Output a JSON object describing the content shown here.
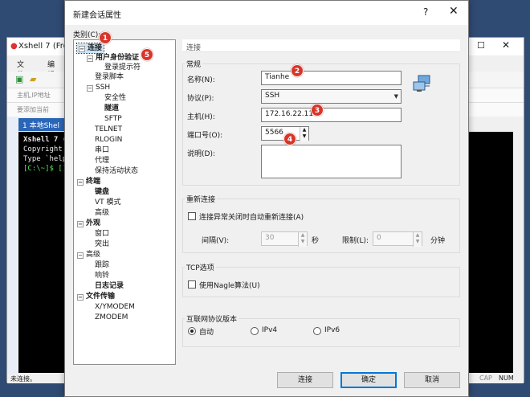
{
  "bg": {
    "title": "Xshell 7 (Fre",
    "menu": [
      "文件(F)",
      "编辑("
    ],
    "addr_hint": "主机,IP地址",
    "hint2": "要添加当前",
    "tab": "1 本地Shel",
    "term_lines": [
      "Xshell 7 (B",
      "Copyright",
      "",
      "Type `help",
      "[C:\\~]$ []"
    ],
    "status_left": "未连接。",
    "status_right": [
      "CAP",
      "NUM"
    ]
  },
  "dialog": {
    "title": "新建会话属性",
    "help": "?",
    "close": "✕",
    "category_label": "类别(C):",
    "tree": [
      {
        "label": "连接",
        "bold": true,
        "expander": "−",
        "selected": true
      },
      {
        "label": "用户身份验证",
        "bold": true,
        "expander": "−"
      },
      {
        "label": "登录提示符"
      },
      {
        "label": "登录脚本"
      },
      {
        "label": "SSH",
        "expander": "−"
      },
      {
        "label": "安全性"
      },
      {
        "label": "隧道",
        "bold": true
      },
      {
        "label": "SFTP"
      },
      {
        "label": "TELNET"
      },
      {
        "label": "RLOGIN"
      },
      {
        "label": "串口"
      },
      {
        "label": "代理"
      },
      {
        "label": "保持活动状态"
      },
      {
        "label": "终端",
        "bold": true,
        "expander": "−"
      },
      {
        "label": "键盘",
        "bold": true
      },
      {
        "label": "VT 模式"
      },
      {
        "label": "高级"
      },
      {
        "label": "外观",
        "bold": true,
        "expander": "−"
      },
      {
        "label": "窗口"
      },
      {
        "label": "突出"
      },
      {
        "label": "高级",
        "expander": "−"
      },
      {
        "label": "跟踪"
      },
      {
        "label": "响铃"
      },
      {
        "label": "日志记录",
        "bold": true
      },
      {
        "label": "文件传输",
        "bold": true,
        "expander": "−"
      },
      {
        "label": "X/YMODEM"
      },
      {
        "label": "ZMODEM"
      }
    ],
    "panel_header": "连接",
    "general": {
      "title": "常规",
      "name_label": "名称(N):",
      "name_value": "Tianhe",
      "protocol_label": "协议(P):",
      "protocol_value": "SSH",
      "host_label": "主机(H):",
      "host_value": "172.16.22.11",
      "port_label": "端口号(O):",
      "port_value": "5566",
      "desc_label": "说明(D):",
      "desc_value": ""
    },
    "reconnect": {
      "title": "重新连接",
      "checkbox_label": "连接异常关闭时自动重新连接(A)",
      "interval_label": "间隔(V):",
      "interval_value": "30",
      "interval_unit": "秒",
      "limit_label": "限制(L):",
      "limit_value": "0",
      "limit_unit": "分钟"
    },
    "tcp": {
      "title": "TCP选项",
      "nagle_label": "使用Nagle算法(U)"
    },
    "ipver": {
      "title": "互联网协议版本",
      "options": [
        "自动",
        "IPv4",
        "IPv6"
      ],
      "selected": "自动"
    },
    "buttons": {
      "connect": "连接",
      "ok": "确定",
      "cancel": "取消"
    },
    "badges": [
      "1",
      "2",
      "3",
      "4",
      "5"
    ],
    "badge_color": "#d8352a"
  }
}
